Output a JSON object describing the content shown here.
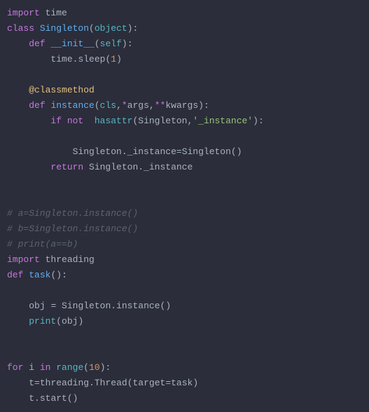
{
  "code": {
    "lines": [
      [
        {
          "t": "import ",
          "c": "kw"
        },
        {
          "t": "time",
          "c": "ident"
        }
      ],
      [
        {
          "t": "class ",
          "c": "kw"
        },
        {
          "t": "Singleton",
          "c": "fn"
        },
        {
          "t": "(",
          "c": "paren"
        },
        {
          "t": "object",
          "c": "builtin"
        },
        {
          "t": ")",
          "c": "paren"
        },
        {
          "t": ":",
          "c": "ident"
        }
      ],
      [
        {
          "t": "    ",
          "c": ""
        },
        {
          "t": "def ",
          "c": "kw"
        },
        {
          "t": "__init__",
          "c": "fn"
        },
        {
          "t": "(",
          "c": "paren"
        },
        {
          "t": "self",
          "c": "builtin"
        },
        {
          "t": ")",
          "c": "paren"
        },
        {
          "t": ":",
          "c": "ident"
        }
      ],
      [
        {
          "t": "        ",
          "c": ""
        },
        {
          "t": "time",
          "c": "ident"
        },
        {
          "t": ".",
          "c": "dot"
        },
        {
          "t": "sleep",
          "c": "attr"
        },
        {
          "t": "(",
          "c": "paren"
        },
        {
          "t": "1",
          "c": "num"
        },
        {
          "t": ")",
          "c": "paren"
        }
      ],
      [
        {
          "t": " ",
          "c": ""
        }
      ],
      [
        {
          "t": "    ",
          "c": ""
        },
        {
          "t": "@classmethod",
          "c": "dec"
        }
      ],
      [
        {
          "t": "    ",
          "c": ""
        },
        {
          "t": "def ",
          "c": "kw"
        },
        {
          "t": "instance",
          "c": "fn"
        },
        {
          "t": "(",
          "c": "paren"
        },
        {
          "t": "cls",
          "c": "builtin"
        },
        {
          "t": ",",
          "c": "ident"
        },
        {
          "t": "*",
          "c": "op"
        },
        {
          "t": "args",
          "c": "ident"
        },
        {
          "t": ",",
          "c": "ident"
        },
        {
          "t": "**",
          "c": "op"
        },
        {
          "t": "kwargs",
          "c": "ident"
        },
        {
          "t": ")",
          "c": "paren"
        },
        {
          "t": ":",
          "c": "ident"
        }
      ],
      [
        {
          "t": "        ",
          "c": ""
        },
        {
          "t": "if ",
          "c": "kw"
        },
        {
          "t": "not  ",
          "c": "kw"
        },
        {
          "t": "hasattr",
          "c": "builtin"
        },
        {
          "t": "(",
          "c": "paren"
        },
        {
          "t": "Singleton",
          "c": "ident"
        },
        {
          "t": ",",
          "c": "ident"
        },
        {
          "t": "'_instance'",
          "c": "str"
        },
        {
          "t": ")",
          "c": "paren"
        },
        {
          "t": ":",
          "c": "ident"
        }
      ],
      [
        {
          "t": " ",
          "c": ""
        }
      ],
      [
        {
          "t": "            ",
          "c": ""
        },
        {
          "t": "Singleton",
          "c": "ident"
        },
        {
          "t": ".",
          "c": "dot"
        },
        {
          "t": "_instance",
          "c": "attr"
        },
        {
          "t": "=",
          "c": "ident"
        },
        {
          "t": "Singleton",
          "c": "ident"
        },
        {
          "t": "(",
          "c": "paren"
        },
        {
          "t": ")",
          "c": "paren"
        }
      ],
      [
        {
          "t": "        ",
          "c": ""
        },
        {
          "t": "return ",
          "c": "kw"
        },
        {
          "t": "Singleton",
          "c": "ident"
        },
        {
          "t": ".",
          "c": "dot"
        },
        {
          "t": "_instance",
          "c": "attr"
        }
      ],
      [
        {
          "t": " ",
          "c": ""
        }
      ],
      [
        {
          "t": " ",
          "c": ""
        }
      ],
      [
        {
          "t": "# a=Singleton.instance()",
          "c": "comment"
        }
      ],
      [
        {
          "t": "# b=Singleton.instance()",
          "c": "comment"
        }
      ],
      [
        {
          "t": "# print(a==b)",
          "c": "comment"
        }
      ],
      [
        {
          "t": "import ",
          "c": "kw"
        },
        {
          "t": "threading",
          "c": "ident"
        }
      ],
      [
        {
          "t": "def ",
          "c": "kw"
        },
        {
          "t": "task",
          "c": "fn"
        },
        {
          "t": "(",
          "c": "paren"
        },
        {
          "t": ")",
          "c": "paren"
        },
        {
          "t": ":",
          "c": "ident"
        }
      ],
      [
        {
          "t": " ",
          "c": ""
        }
      ],
      [
        {
          "t": "    ",
          "c": ""
        },
        {
          "t": "obj ",
          "c": "ident"
        },
        {
          "t": "= ",
          "c": "ident"
        },
        {
          "t": "Singleton",
          "c": "ident"
        },
        {
          "t": ".",
          "c": "dot"
        },
        {
          "t": "instance",
          "c": "attr"
        },
        {
          "t": "(",
          "c": "paren"
        },
        {
          "t": ")",
          "c": "paren"
        }
      ],
      [
        {
          "t": "    ",
          "c": ""
        },
        {
          "t": "print",
          "c": "builtin"
        },
        {
          "t": "(",
          "c": "paren"
        },
        {
          "t": "obj",
          "c": "ident"
        },
        {
          "t": ")",
          "c": "paren"
        }
      ],
      [
        {
          "t": " ",
          "c": ""
        }
      ],
      [
        {
          "t": " ",
          "c": ""
        }
      ],
      [
        {
          "t": "for ",
          "c": "kw"
        },
        {
          "t": "i",
          "c": "ident"
        },
        {
          "t": " in ",
          "c": "kw"
        },
        {
          "t": "range",
          "c": "builtin"
        },
        {
          "t": "(",
          "c": "paren"
        },
        {
          "t": "10",
          "c": "num"
        },
        {
          "t": ")",
          "c": "paren"
        },
        {
          "t": ":",
          "c": "ident"
        }
      ],
      [
        {
          "t": "    ",
          "c": ""
        },
        {
          "t": "t",
          "c": "ident"
        },
        {
          "t": "=",
          "c": "ident"
        },
        {
          "t": "threading",
          "c": "ident"
        },
        {
          "t": ".",
          "c": "dot"
        },
        {
          "t": "Thread",
          "c": "attr"
        },
        {
          "t": "(",
          "c": "paren"
        },
        {
          "t": "target",
          "c": "ident"
        },
        {
          "t": "=",
          "c": "ident"
        },
        {
          "t": "task",
          "c": "ident"
        },
        {
          "t": ")",
          "c": "paren"
        }
      ],
      [
        {
          "t": "    ",
          "c": ""
        },
        {
          "t": "t",
          "c": "ident"
        },
        {
          "t": ".",
          "c": "dot"
        },
        {
          "t": "start",
          "c": "attr"
        },
        {
          "t": "(",
          "c": "paren"
        },
        {
          "t": ")",
          "c": "paren"
        }
      ]
    ]
  }
}
